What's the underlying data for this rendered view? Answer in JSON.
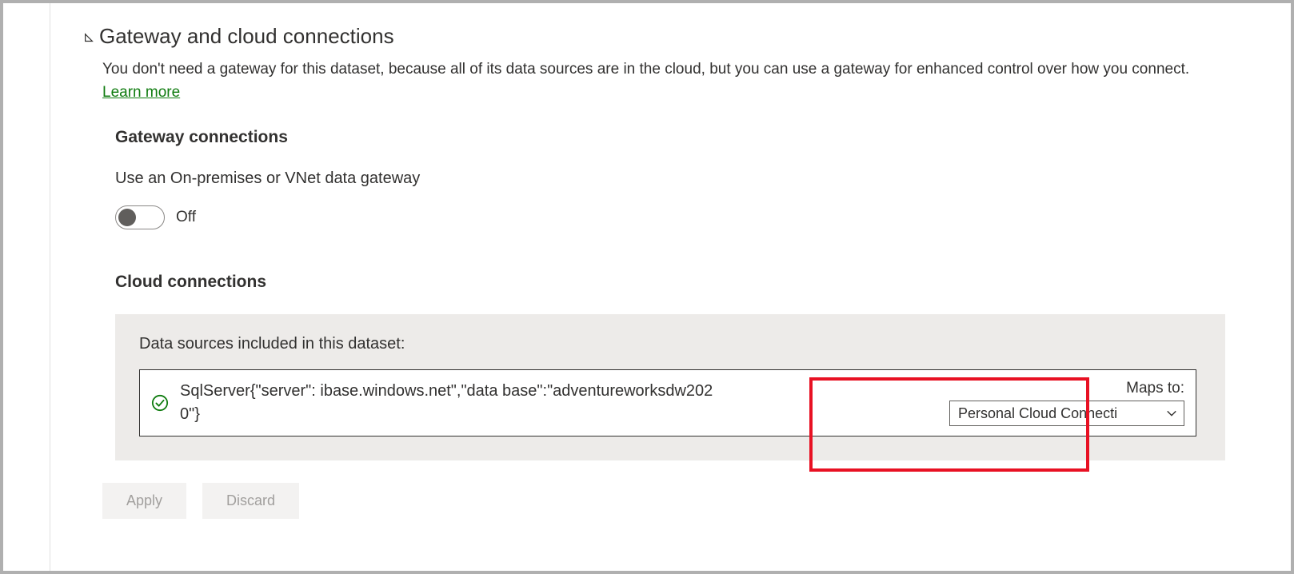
{
  "section": {
    "title": "Gateway and cloud connections",
    "description_pre": "You don't need a gateway for this dataset, because all of its data sources are in the cloud, but you can use a gateway for enhanced control over how you connect. ",
    "learn_more": "Learn more"
  },
  "gateway": {
    "title": "Gateway connections",
    "label": "Use an On-premises or VNet data gateway",
    "toggle_state": "Off"
  },
  "cloud": {
    "title": "Cloud connections",
    "panel_label": "Data sources included in this dataset:",
    "datasource": {
      "text": "SqlServer{\"server\":                            ibase.windows.net\",\"data base\":\"adventureworksdw2020\"}",
      "maps_to_label": "Maps to:",
      "selected": "Personal Cloud Connecti"
    }
  },
  "buttons": {
    "apply": "Apply",
    "discard": "Discard"
  }
}
